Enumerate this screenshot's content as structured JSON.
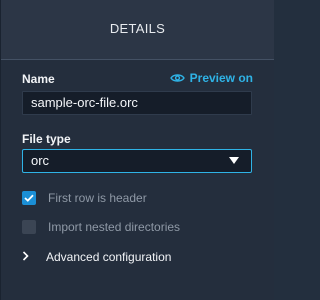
{
  "header": {
    "title": "DETAILS"
  },
  "name_field": {
    "label": "Name",
    "value": "sample-orc-file.orc",
    "preview_label": "Preview on"
  },
  "file_type": {
    "label": "File type",
    "selected": "orc"
  },
  "options": {
    "first_row_header": {
      "label": "First row is header",
      "checked": true
    },
    "import_nested": {
      "label": "Import nested directories",
      "checked": false
    }
  },
  "advanced": {
    "label": "Advanced configuration"
  },
  "colors": {
    "accent": "#2fb3e6",
    "checkbox_checked": "#1b8fd6",
    "background": "#242e3d",
    "header_background": "#2c3646"
  },
  "icons": {
    "preview": "eye-icon",
    "dropdown": "caret-down-icon",
    "check": "checkmark-icon",
    "expand": "chevron-right-icon"
  }
}
